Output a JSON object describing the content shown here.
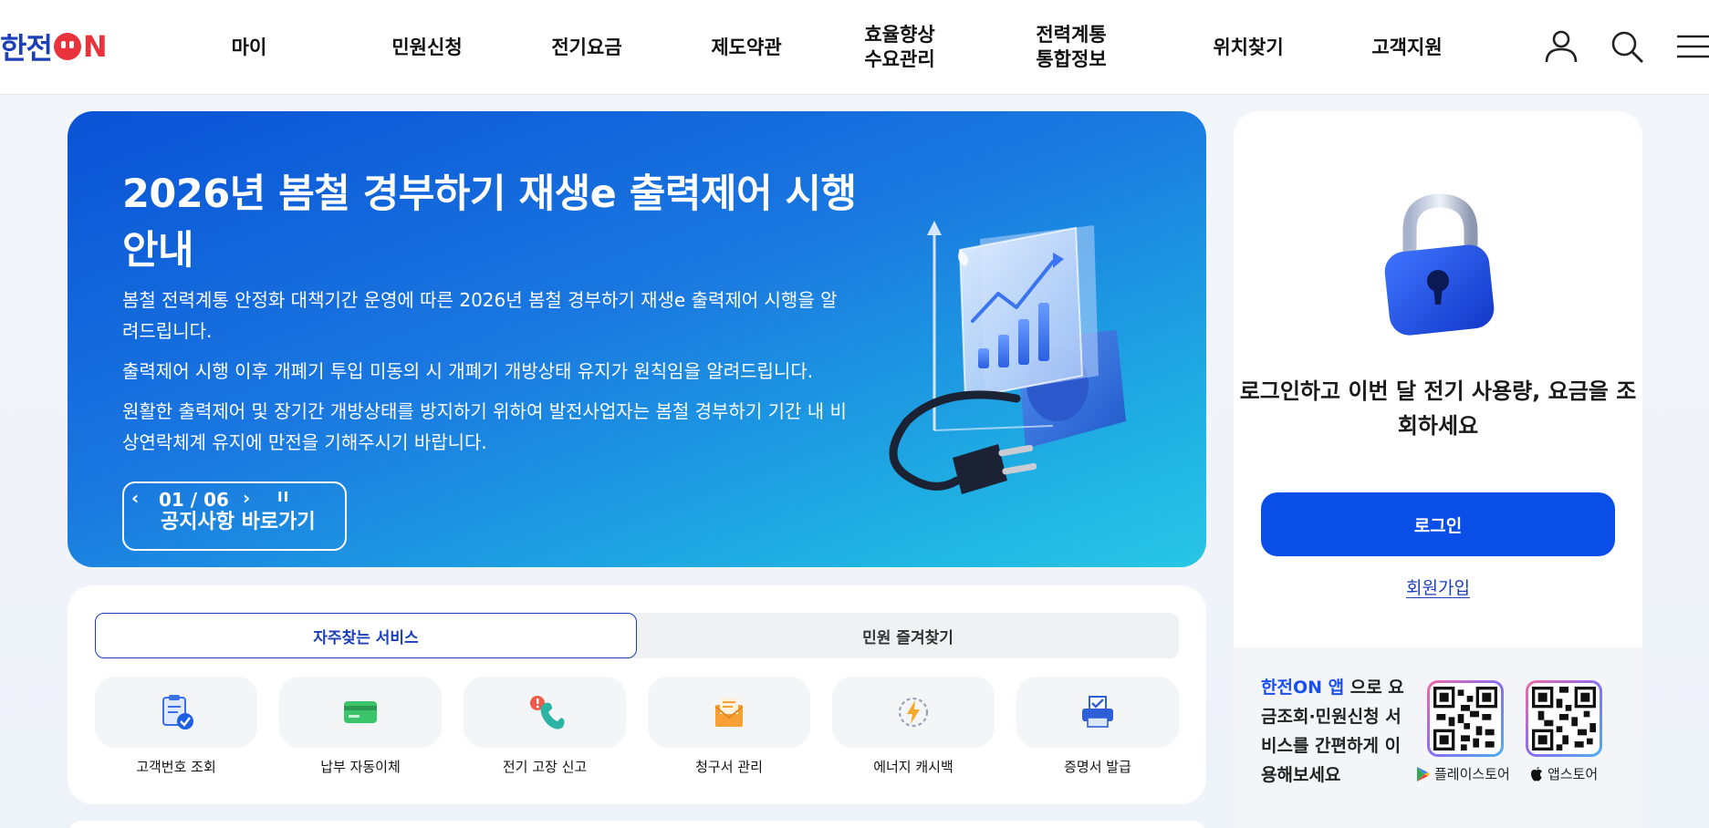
{
  "header": {
    "logo_text_1": "한전",
    "logo_text_2": "N",
    "nav": [
      {
        "label": "마이"
      },
      {
        "label": "민원신청"
      },
      {
        "label": "전기요금"
      },
      {
        "label": "제도약관"
      },
      {
        "label": "효율향상\n수요관리"
      },
      {
        "label": "전력계통\n통합정보"
      },
      {
        "label": "위치찾기"
      },
      {
        "label": "고객지원"
      }
    ],
    "icons": [
      "user-icon",
      "search-icon",
      "menu-icon"
    ]
  },
  "banner": {
    "title": "2026년 봄철 경부하기 재생e 출력제어 시행 안내",
    "desc_1": "봄철 전력계통 안정화 대책기간 운영에 따른 2026년 봄철 경부하기 재생e 출력제어 시행을 알려드립니다.",
    "desc_2": "출력제어 시행 이후 개폐기 투입 미동의 시 개폐기 개방상태 유지가 원칙임을 알려드립니다.",
    "desc_3": "원활한 출력제어 및 장기간 개방상태를 방지하기 위하여 발전사업자는 봄철 경부하기 기간 내 비상연락체계 유지에 만전을 기해주시기 바랍니다.",
    "prev": "‹",
    "counter": "01 / 06",
    "next": "›",
    "pause": "II",
    "link_label": "공지사항 바로가기"
  },
  "services": {
    "tabs": [
      {
        "label": "자주찾는 서비스",
        "active": true
      },
      {
        "label": "민원 즐겨찾기",
        "active": false
      }
    ],
    "items": [
      {
        "label": "고객번호 조회",
        "icon": "clipboard-check-icon"
      },
      {
        "label": "납부 자동이체",
        "icon": "card-icon"
      },
      {
        "label": "전기 고장 신고",
        "icon": "phone-alert-icon"
      },
      {
        "label": "청구서 관리",
        "icon": "envelope-icon"
      },
      {
        "label": "에너지 캐시백",
        "icon": "energy-cashback-icon"
      },
      {
        "label": "증명서 발급",
        "icon": "printer-icon"
      }
    ]
  },
  "login": {
    "message": "로그인하고 이번 달 전기 사용량, 요금을 조회하세요",
    "button": "로그인",
    "signup": "회원가입",
    "app_highlight": "한전ON 앱",
    "app_text": " 으로 요금조회·민원신청 서비스를 간편하게 이용해보세요",
    "play_store": "플레이스토어",
    "app_store": "앱스토어"
  },
  "colors": {
    "brand_blue": "#1a3fb8",
    "brand_red": "#e8323c",
    "login_button": "#0a4ee8"
  }
}
